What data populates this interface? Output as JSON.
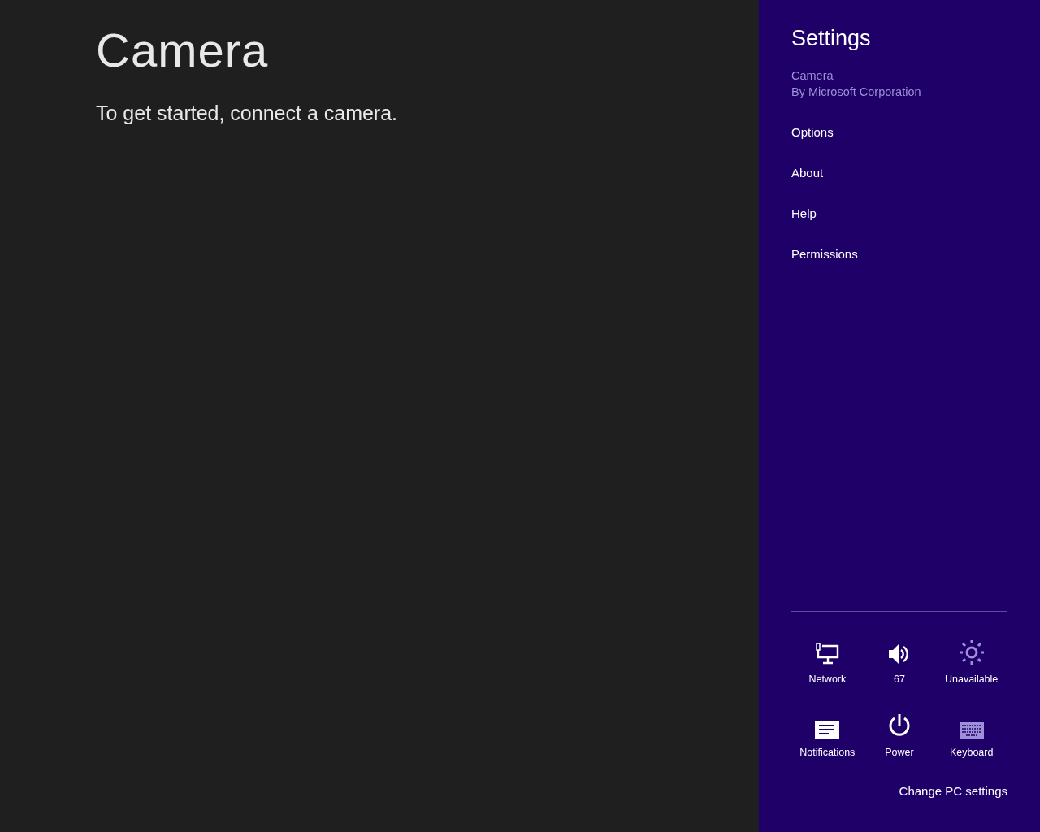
{
  "app": {
    "title": "Camera",
    "message": "To get started, connect a camera."
  },
  "settings": {
    "title": "Settings",
    "app_name": "Camera",
    "publisher": "By Microsoft Corporation",
    "items": [
      "Options",
      "About",
      "Help",
      "Permissions"
    ],
    "quick": [
      {
        "kind": "network",
        "label": "Network",
        "disabled": false
      },
      {
        "kind": "volume",
        "label": "67",
        "disabled": false
      },
      {
        "kind": "brightness",
        "label": "Unavailable",
        "disabled": true
      },
      {
        "kind": "notifications",
        "label": "Notifications",
        "disabled": false
      },
      {
        "kind": "power",
        "label": "Power",
        "disabled": false
      },
      {
        "kind": "keyboard",
        "label": "Keyboard",
        "disabled": true
      }
    ],
    "change_link": "Change PC settings"
  }
}
